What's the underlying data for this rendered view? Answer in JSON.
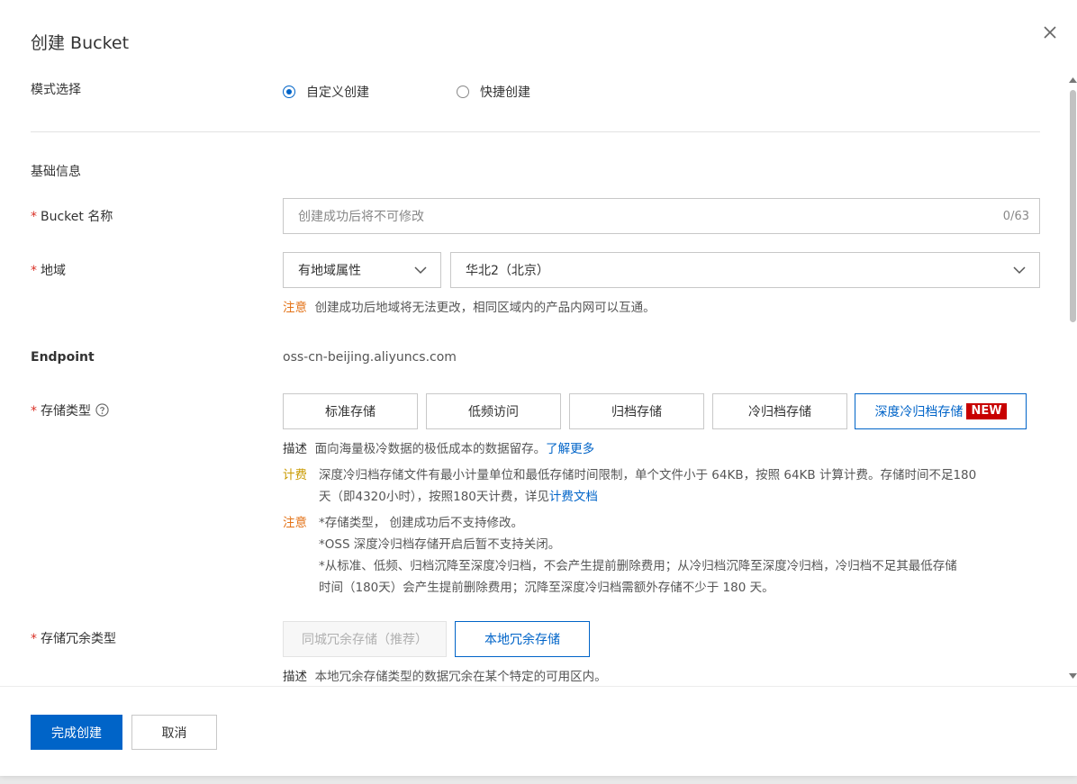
{
  "dialog": {
    "title": "创建 Bucket"
  },
  "mode": {
    "label": "模式选择",
    "options": [
      {
        "label": "自定义创建",
        "checked": true
      },
      {
        "label": "快捷创建",
        "checked": false
      }
    ]
  },
  "basic": {
    "section_title": "基础信息"
  },
  "bucket_name": {
    "required_mark": "*",
    "label": "Bucket 名称",
    "placeholder": "创建成功后将不可修改",
    "counter": "0/63"
  },
  "region": {
    "required_mark": "*",
    "label": "地域",
    "attribute_select": "有地域属性",
    "region_select": "华北2（北京）",
    "note_tag": "注意",
    "note_text": "创建成功后地域将无法更改，相同区域内的产品内网可以互通。"
  },
  "endpoint": {
    "label": "Endpoint",
    "value": "oss-cn-beijing.aliyuncs.com"
  },
  "storage_class": {
    "required_mark": "*",
    "label": "存储类型",
    "options": [
      "标准存储",
      "低频访问",
      "归档存储",
      "冷归档存储",
      "深度冷归档存储"
    ],
    "selected": "深度冷归档存储",
    "new_badge": "NEW",
    "desc_tag": "描述",
    "desc_text": "面向海量极冷数据的极低成本的数据留存。",
    "desc_link": "了解更多",
    "fee_tag": "计费",
    "fee_line1": "深度冷归档存储文件有最小计量单位和最低存储时间限制，单个文件小于 64KB，按照 64KB 计算计费。存储时间不足180",
    "fee_line2": "天（即4320小时），按照180天计费，详见",
    "fee_link": "计费文档",
    "note_tag": "注意",
    "note_line1": "*存储类型， 创建成功后不支持修改。",
    "note_line2": "*OSS 深度冷归档存储开启后暂不支持关闭。",
    "note_line3": "*从标准、低频、归档沉降至深度冷归档，不会产生提前删除费用；从冷归档沉降至深度冷归档，冷归档不足其最低存储",
    "note_line4": "时间（180天）会产生提前删除费用；沉降至深度冷归档需额外存储不少于 180 天。"
  },
  "redundancy": {
    "required_mark": "*",
    "label": "存储冗余类型",
    "options": [
      "同城冗余存储（推荐）",
      "本地冗余存储"
    ],
    "selected": "本地冗余存储",
    "desc_tag": "描述",
    "desc_text": "本地冗余存储类型的数据冗余在某个特定的可用区内。"
  },
  "footer": {
    "submit": "完成创建",
    "cancel": "取消"
  },
  "colors": {
    "accent": "#0064c8",
    "required": "#d93026",
    "warning": "#e37318",
    "fee": "#c99a00",
    "new_badge": "#c80000"
  }
}
